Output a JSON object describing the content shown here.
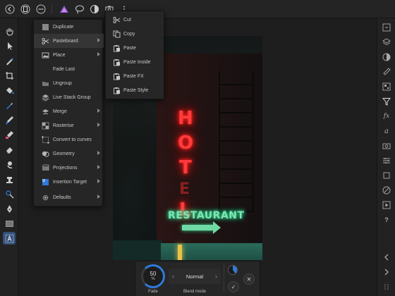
{
  "topbar": {
    "icons": [
      "back-icon",
      "document-icon",
      "more-icon",
      "persona-icon",
      "lasso-icon",
      "color-wheel-icon",
      "camera-icon",
      "overflow-icon"
    ]
  },
  "menu": {
    "items": [
      {
        "label": "Duplicate",
        "icon": "duplicate-icon",
        "submenu": false
      },
      {
        "label": "Pasteboard",
        "icon": "scissors-icon",
        "submenu": true
      },
      {
        "label": "Place",
        "icon": "image-icon",
        "submenu": true
      },
      {
        "label": "Fade Last",
        "icon": "none",
        "submenu": false
      },
      {
        "label": "Ungroup",
        "icon": "folder-icon",
        "submenu": false
      },
      {
        "label": "Live Stack Group",
        "icon": "stack-icon",
        "submenu": false
      },
      {
        "label": "Merge",
        "icon": "merge-icon",
        "submenu": true
      },
      {
        "label": "Rasterise",
        "icon": "checker-icon",
        "submenu": true
      },
      {
        "label": "Convert to curves",
        "icon": "curve-icon",
        "submenu": false
      },
      {
        "label": "Geometry",
        "icon": "geometry-icon",
        "submenu": true
      },
      {
        "label": "Projections",
        "icon": "projection-icon",
        "submenu": true
      },
      {
        "label": "Insertion Target",
        "icon": "target-icon",
        "submenu": true
      },
      {
        "label": "Defaults",
        "icon": "gear-icon",
        "submenu": true
      }
    ]
  },
  "submenu": {
    "items": [
      {
        "label": "Cut",
        "icon": "scissors-icon"
      },
      {
        "label": "Copy",
        "icon": "copy-icon"
      },
      {
        "label": "Paste",
        "icon": "paste-icon"
      },
      {
        "label": "Paste Inside",
        "icon": "paste-icon"
      },
      {
        "label": "Paste FX",
        "icon": "paste-icon"
      },
      {
        "label": "Paste Style",
        "icon": "paste-icon"
      }
    ]
  },
  "context": {
    "fade_value": "50",
    "fade_unit": "%",
    "fade_label": "Fade",
    "blend_value": "Normal",
    "blend_label": "Blend mode",
    "fade_percent": 50
  },
  "canvas": {
    "neon_letters": [
      "H",
      "O",
      "T",
      "E",
      "L"
    ],
    "sign_text": "RESTAURANT"
  },
  "colors": {
    "accent": "#2f7ad8",
    "neon_red": "#ff3b3b",
    "neon_green": "#7fe3b3"
  }
}
